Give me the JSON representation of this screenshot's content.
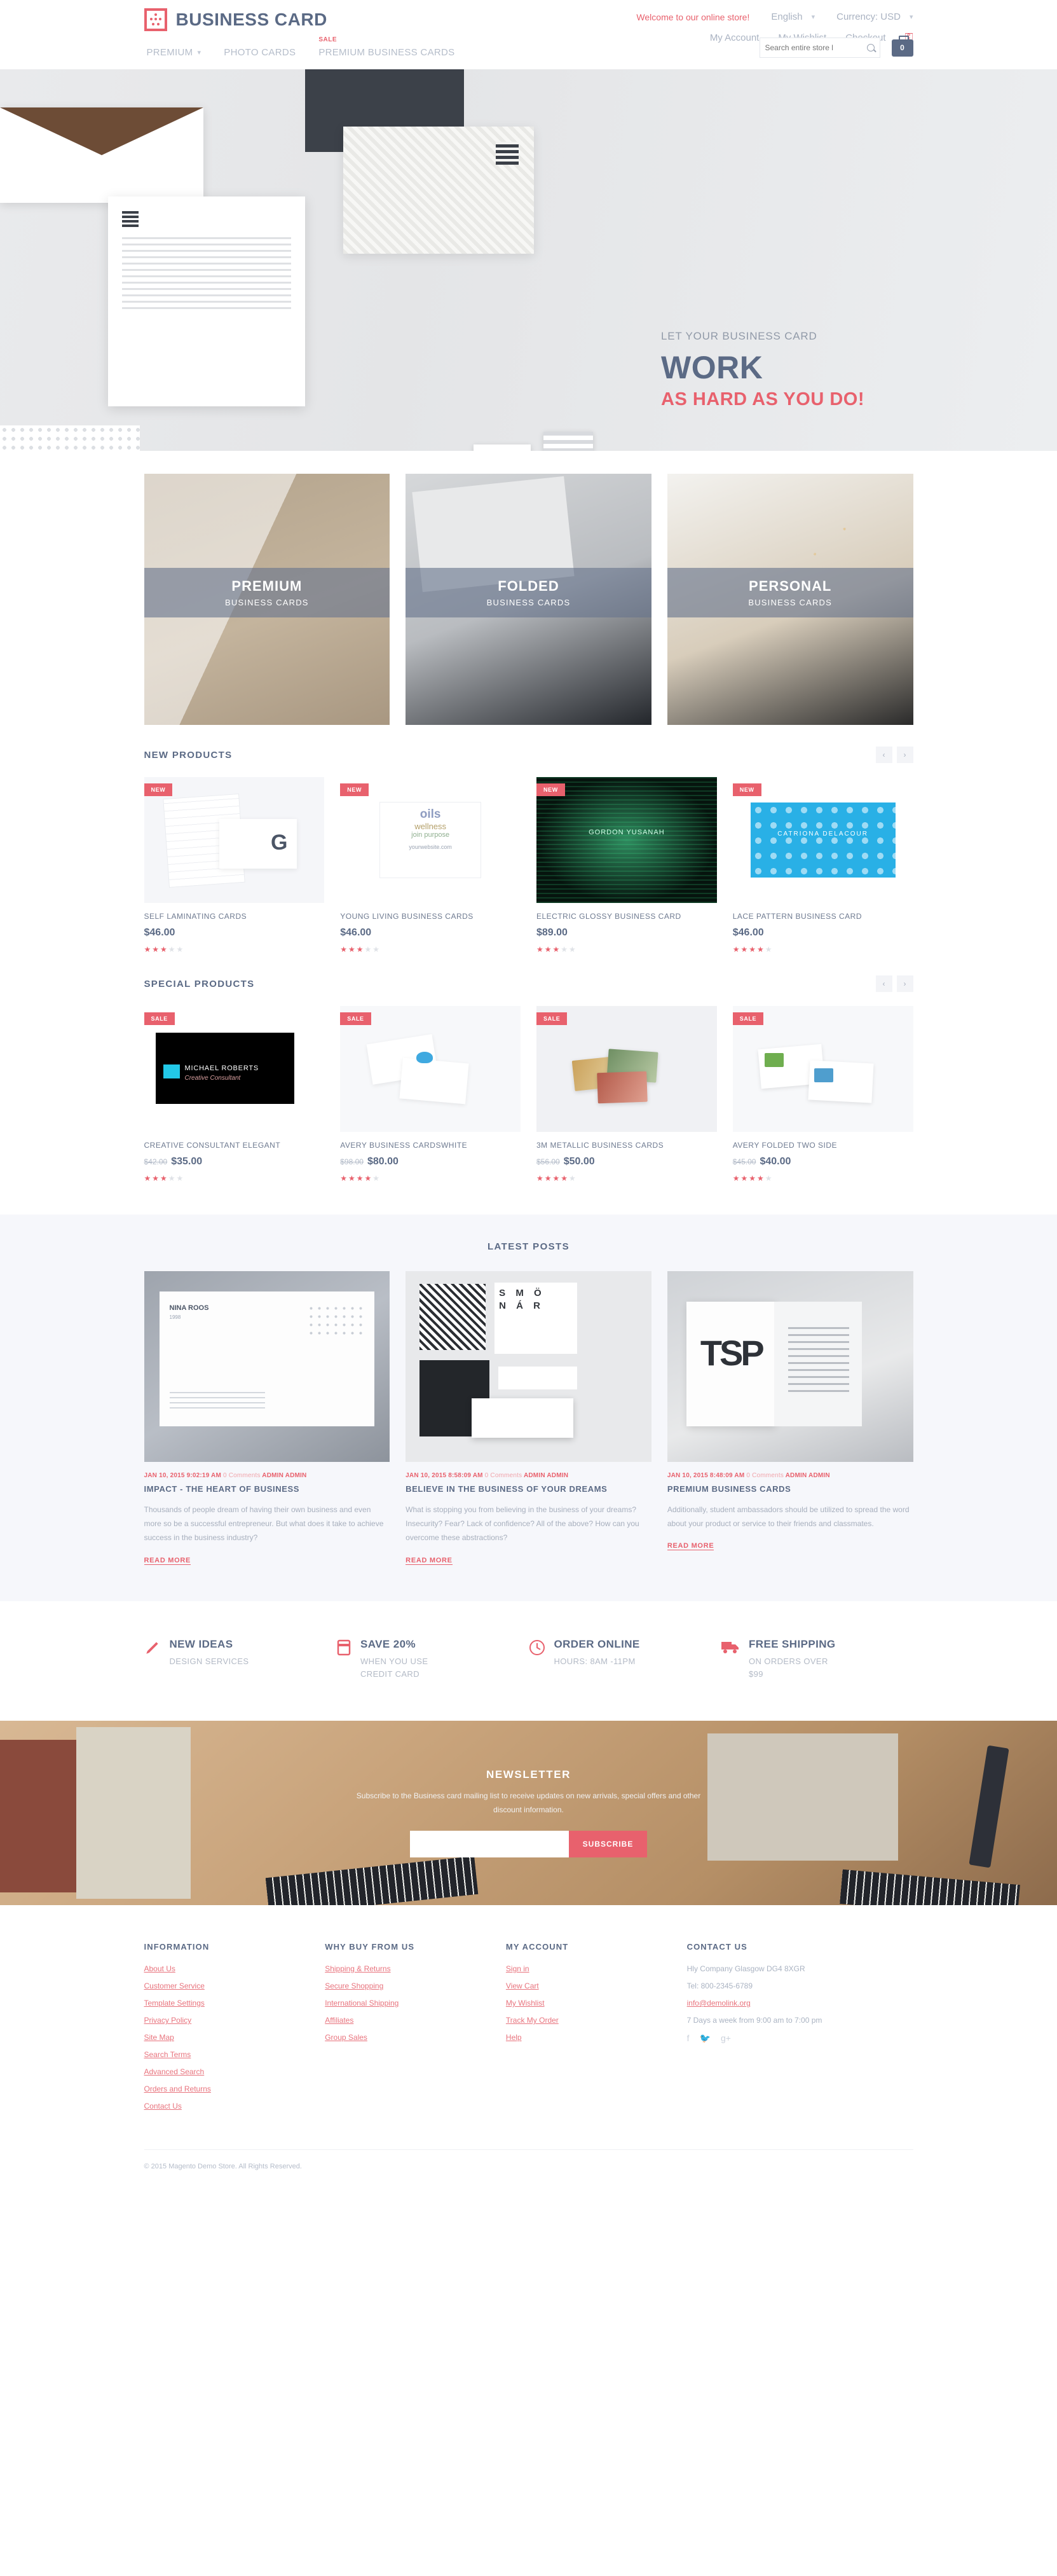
{
  "topbar": {
    "welcome": "Welcome to our online store!",
    "language": "English",
    "currency": "Currency: USD",
    "links": [
      "My Account",
      "My Wishlist",
      "Checkout"
    ],
    "key_icon": "key-icon"
  },
  "header": {
    "logo_text": "BUSINESS CARD",
    "nav": [
      {
        "label": "PREMIUM",
        "caret": "⌄",
        "badge": ""
      },
      {
        "label": "PHOTO CARDS",
        "caret": "",
        "badge": ""
      },
      {
        "label": "PREMIUM BUSINESS CARDS",
        "caret": "",
        "badge": "SALE"
      }
    ],
    "search_placeholder": "Search entire store l",
    "cart_count": "0"
  },
  "hero": {
    "pretitle": "LET YOUR BUSINESS CARD",
    "title": "WORK",
    "subtitle": "AS HARD AS YOU DO!",
    "prev": "‹",
    "next": "›"
  },
  "categories": [
    {
      "title": "PREMIUM",
      "subtitle": "BUSINESS CARDS"
    },
    {
      "title": "FOLDED",
      "subtitle": "BUSINESS CARDS"
    },
    {
      "title": "PERSONAL",
      "subtitle": "BUSINESS CARDS"
    }
  ],
  "new_products": {
    "title": "NEW PRODUCTS",
    "prev": "‹",
    "next": "›",
    "items": [
      {
        "badge": "NEW",
        "name": "SELF LAMINATING CARDS",
        "price": "$46.00",
        "old_price": "",
        "rating": 3
      },
      {
        "badge": "NEW",
        "name": "YOUNG LIVING BUSINESS CARDS",
        "price": "$46.00",
        "old_price": "",
        "rating": 3
      },
      {
        "badge": "NEW",
        "name": "ELECTRIC GLOSSY BUSINESS CARD",
        "price": "$89.00",
        "old_price": "",
        "rating": 3
      },
      {
        "badge": "NEW",
        "name": "LACE PATTERN BUSINESS CARD",
        "price": "$46.00",
        "old_price": "",
        "rating": 4
      }
    ]
  },
  "special_products": {
    "title": "SPECIAL PRODUCTS",
    "prev": "‹",
    "next": "›",
    "items": [
      {
        "badge": "SALE",
        "name": "CREATIVE CONSULTANT ELEGANT",
        "price": "$35.00",
        "old_price": "$42.00",
        "rating": 3
      },
      {
        "badge": "SALE",
        "name": "AVERY BUSINESS CARDSWHITE",
        "price": "$80.00",
        "old_price": "$98.00",
        "rating": 4
      },
      {
        "badge": "SALE",
        "name": "3M METALLIC BUSINESS CARDS",
        "price": "$50.00",
        "old_price": "$56.00",
        "rating": 4
      },
      {
        "badge": "SALE",
        "name": "AVERY FOLDED TWO SIDE",
        "price": "$40.00",
        "old_price": "$45.00",
        "rating": 4
      }
    ]
  },
  "blog": {
    "title": "LATEST POSTS",
    "posts": [
      {
        "date": "JAN 10, 2015 9:02:19 AM",
        "comments": "0 Comments",
        "author": "ADMIN ADMIN",
        "heading": "IMPACT - THE HEART OF BUSINESS",
        "excerpt": "Thousands of people dream of having their own business and even more so be a successful entrepreneur. But what does it take to achieve success in the business industry?",
        "read_more": "READ MORE"
      },
      {
        "date": "JAN 10, 2015 8:58:09 AM",
        "comments": "0 Comments",
        "author": "ADMIN ADMIN",
        "heading": "BELIEVE IN THE BUSINESS OF YOUR DREAMS",
        "excerpt": "What is stopping you from believing in the business of your dreams? Insecurity? Fear? Lack of confidence? All of the above? How can you overcome these abstractions?",
        "read_more": "READ MORE"
      },
      {
        "date": "JAN 10, 2015 8:48:09 AM",
        "comments": "0 Comments",
        "author": "ADMIN ADMIN",
        "heading": "PREMIUM BUSINESS CARDS",
        "excerpt": "Additionally, student ambassadors should be utilized to spread the word about your product or service to their friends and classmates.",
        "read_more": "READ MORE"
      }
    ]
  },
  "services": [
    {
      "icon": "pen-icon",
      "title": "NEW IDEAS",
      "subtitle": "DESIGN SERVICES"
    },
    {
      "icon": "credit-card-icon",
      "title": "SAVE 20%",
      "subtitle": "WHEN YOU USE CREDIT CARD"
    },
    {
      "icon": "clock-icon",
      "title": "ORDER ONLINE",
      "subtitle": "HOURS: 8AM -11PM"
    },
    {
      "icon": "truck-icon",
      "title": "FREE SHIPPING",
      "subtitle": "ON ORDERS OVER $99"
    }
  ],
  "newsletter": {
    "title": "NEWSLETTER",
    "text": "Subscribe to the Business card mailing list to receive updates on new arrivals, special offers and other discount information.",
    "input_value": "",
    "input_placeholder": "",
    "button": "SUBSCRIBE"
  },
  "footer": {
    "columns": [
      {
        "heading": "INFORMATION",
        "links": [
          "About Us",
          "Customer Service",
          "Template Settings",
          "Privacy Policy",
          "Site Map",
          "Search Terms",
          "Advanced Search",
          "Orders and Returns",
          "Contact Us"
        ]
      },
      {
        "heading": "WHY BUY FROM US",
        "links": [
          "Shipping & Returns",
          "Secure Shopping",
          "International Shipping",
          "Affiliates",
          "Group Sales"
        ]
      },
      {
        "heading": "MY ACCOUNT",
        "links": [
          "Sign in",
          "View Cart",
          "My Wishlist",
          "Track My Order",
          "Help"
        ]
      }
    ],
    "contact": {
      "heading": "CONTACT US",
      "address": "Hly Company Glasgow DG4 8XGR",
      "phone": "Tel: 800-2345-6789",
      "email": "info@demolink.org",
      "hours": "7 Days a week from 9:00 am to 7:00 pm",
      "socials": [
        "facebook-icon",
        "twitter-icon",
        "google-plus-icon"
      ]
    },
    "copyright": "© 2015 Magento Demo Store. All Rights Reserved."
  }
}
